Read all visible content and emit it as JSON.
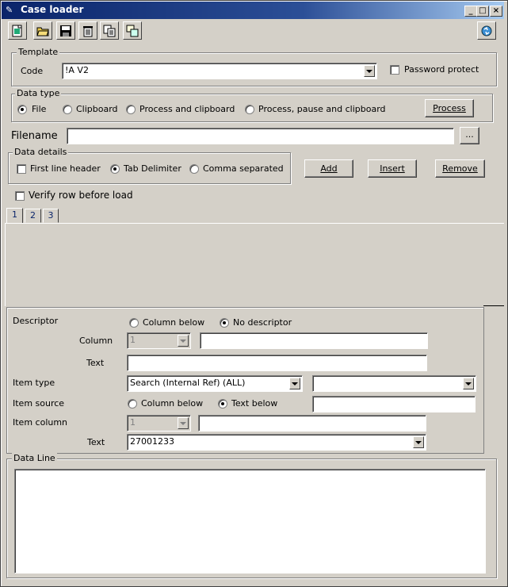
{
  "window": {
    "title": "Case loader"
  },
  "toolbar": {
    "buttons": [
      "new-icon",
      "open-icon",
      "save-icon",
      "delete-icon",
      "copy-icon",
      "paste-icon"
    ],
    "right_icon": "refresh-icon"
  },
  "template": {
    "legend": "Template",
    "code_label": "Code",
    "code_value": "!A V2",
    "password_label": "Password protect"
  },
  "data_type": {
    "legend": "Data type",
    "options": [
      "File",
      "Clipboard",
      "Process and clipboard",
      "Process, pause and clipboard"
    ],
    "selected": "File",
    "process_button": "Process"
  },
  "filename": {
    "label": "Filename",
    "value": "",
    "browse": "..."
  },
  "data_details": {
    "legend": "Data details",
    "first_line_header": "First line header",
    "tab_delimiter": "Tab Delimiter",
    "comma_separated": "Comma separated",
    "selected": "Tab Delimiter"
  },
  "actions": {
    "add": "Add",
    "insert": "Insert",
    "remove": "Remove"
  },
  "verify": {
    "label": "Verify row before load"
  },
  "tabs": [
    "1",
    "2",
    "3"
  ],
  "descriptor": {
    "label": "Descriptor",
    "opt_column_below": "Column below",
    "opt_no_descriptor": "No descriptor",
    "selected": "No descriptor",
    "column_label": "Column",
    "column_value": "1",
    "text_label": "Text",
    "text_value": ""
  },
  "item": {
    "type_label": "Item type",
    "type_value": "Search (Internal Ref) (ALL)",
    "type_extra": "",
    "source_label": "Item source",
    "opt_column_below": "Column below",
    "opt_text_below": "Text below",
    "source_selected": "Text below",
    "source_text": "",
    "column_label": "Item column",
    "column_value": "1",
    "column_text": "",
    "text_label": "Text",
    "text_value": "27001233"
  },
  "data_line": {
    "legend": "Data Line",
    "value": ""
  }
}
